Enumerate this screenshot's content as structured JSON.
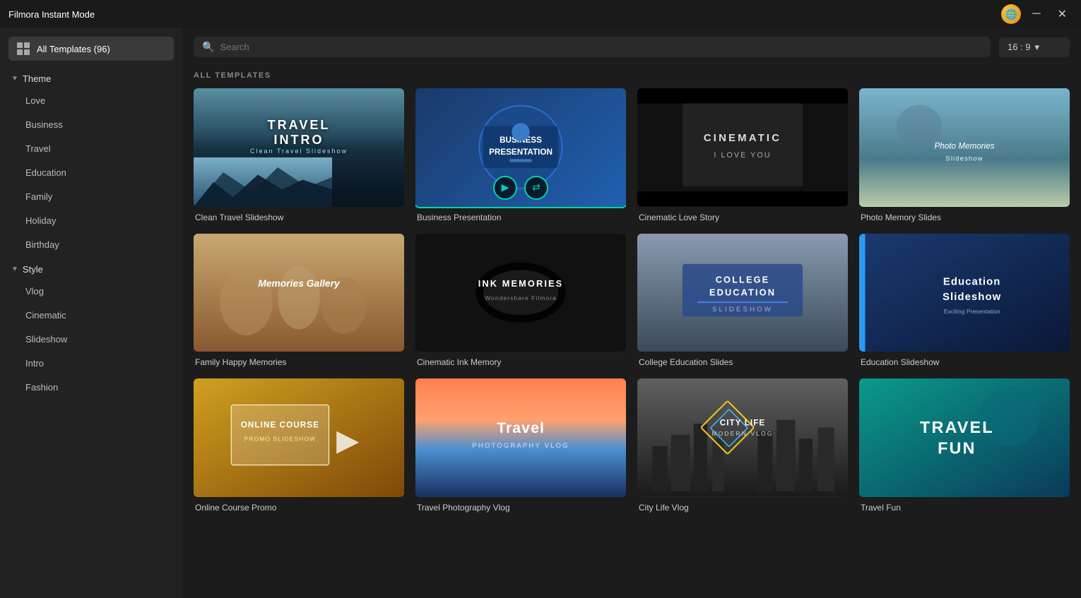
{
  "titleBar": {
    "title": "Filmora Instant Mode",
    "minimizeLabel": "─",
    "closeLabel": "✕"
  },
  "sidebar": {
    "allTemplatesLabel": "All Templates (96)",
    "themeLabel": "Theme",
    "themeItems": [
      "Love",
      "Business",
      "Travel",
      "Education",
      "Family",
      "Holiday",
      "Birthday"
    ],
    "styleLabel": "Style",
    "styleItems": [
      "Vlog",
      "Cinematic",
      "Slideshow",
      "Intro",
      "Fashion"
    ]
  },
  "search": {
    "placeholder": "Search",
    "aspectRatio": "16 : 9"
  },
  "sectionLabel": "ALL TEMPLATES",
  "templates": [
    {
      "id": "clean-travel",
      "label": "Clean Travel Slideshow",
      "theme": "travel-intro",
      "overlayLines": [
        "TRAVEL",
        "INTRO"
      ],
      "selected": false
    },
    {
      "id": "business-presentation",
      "label": "Business Presentation",
      "theme": "business",
      "overlayLines": [
        "BUSINESS",
        "PRESENTATION"
      ],
      "selected": true
    },
    {
      "id": "cinematic-love",
      "label": "Cinematic Love Story",
      "theme": "cinematic",
      "overlayLines": [
        "CINEMATIC",
        "I LOVE YOU"
      ],
      "selected": false
    },
    {
      "id": "photo-memory",
      "label": "Photo Memory Slides",
      "theme": "photo-memory",
      "overlayLines": [
        "Photo Memories",
        "Slideshow"
      ],
      "selected": false
    },
    {
      "id": "family-happy",
      "label": "Family Happy Memories",
      "theme": "family",
      "overlayLines": [
        "Memories Gallery"
      ],
      "selected": false
    },
    {
      "id": "cinematic-ink",
      "label": "Cinematic Ink Memory",
      "theme": "ink",
      "overlayLines": [
        "INK MEMORIES",
        "Wondershare Filmora"
      ],
      "selected": false
    },
    {
      "id": "college-edu",
      "label": "College Education Slides",
      "theme": "college",
      "overlayLines": [
        "COLLEGE",
        "EDUCATION",
        "SLIDESHOW"
      ],
      "selected": false
    },
    {
      "id": "edu-slideshow",
      "label": "Education Slideshow",
      "theme": "edu-slideshow",
      "overlayLines": [
        "Education",
        "Slideshow"
      ],
      "selected": false
    },
    {
      "id": "online-course",
      "label": "Online Course Promo",
      "theme": "online-course",
      "overlayLines": [
        "ONLINE COURSE",
        "PROMO SLIDESHOW"
      ],
      "selected": false
    },
    {
      "id": "travel-vlog",
      "label": "Travel Photography Vlog",
      "theme": "travel-vlog",
      "overlayLines": [
        "Travel",
        "PHOTOGRAPHY VLOG"
      ],
      "selected": false
    },
    {
      "id": "city-life",
      "label": "City Life Vlog",
      "theme": "city-life",
      "overlayLines": [
        "CITY LIFE",
        "MODERN VLOG"
      ],
      "selected": false
    },
    {
      "id": "travel-fun",
      "label": "Travel Fun",
      "theme": "travel-fun",
      "overlayLines": [
        "TRAVEL",
        "FUN"
      ],
      "selected": false
    }
  ],
  "selectedCardActions": {
    "playIcon": "▶",
    "editIcon": "⇄"
  }
}
